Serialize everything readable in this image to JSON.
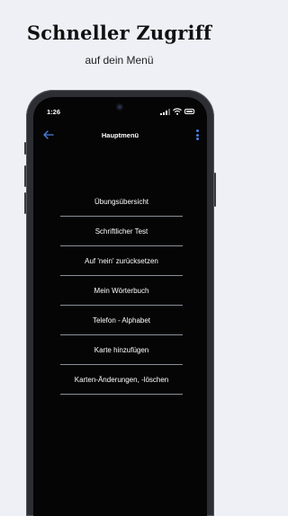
{
  "promo": {
    "title": "Schneller Zugriff",
    "subtitle": "auf dein Menü"
  },
  "status_bar": {
    "time": "1:26",
    "icons": [
      "cellular-signal-icon",
      "wifi-icon",
      "battery-icon"
    ]
  },
  "app_bar": {
    "title": "Hauptmenü",
    "back_icon": "arrow-left-icon",
    "overflow_icon": "more-vertical-icon",
    "accent_color": "#4c7fe0"
  },
  "menu": {
    "items": [
      {
        "label": "Übungsübersicht"
      },
      {
        "label": "Schriftlicher Test"
      },
      {
        "label": "Auf 'nein' zurücksetzen"
      },
      {
        "label": "Mein Wörterbuch"
      },
      {
        "label": "Telefon - Alphabet"
      },
      {
        "label": "Karte hinzufügen"
      },
      {
        "label": "Karten-Änderungen, -löschen"
      }
    ]
  }
}
